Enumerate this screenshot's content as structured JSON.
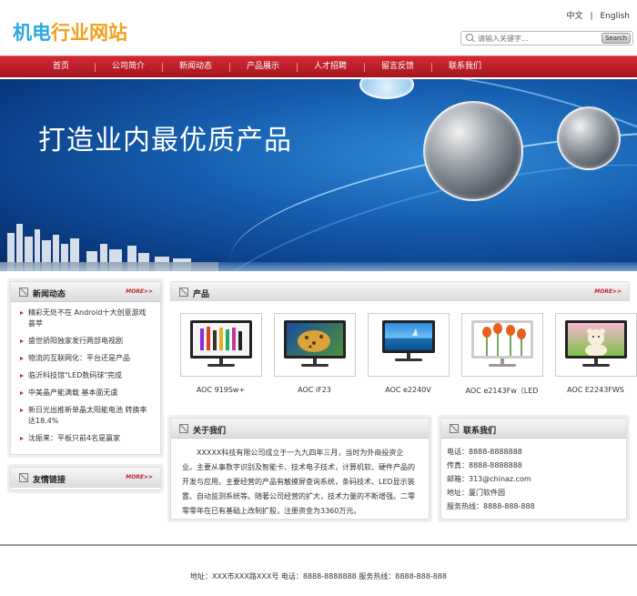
{
  "header": {
    "logo_part1": "机电",
    "logo_part2": "行业网站",
    "lang_cn": "中文",
    "lang_sep": "|",
    "lang_en": "English",
    "search_placeholder": "请输入关键字...",
    "search_button": "Search"
  },
  "nav": [
    "首页",
    "公司简介",
    "新闻动态",
    "产品展示",
    "人才招聘",
    "留言反馈",
    "联系我们"
  ],
  "banner": {
    "slogan": "打造业内最优质产品"
  },
  "news": {
    "title": "新闻动态",
    "more": "MORE>>",
    "items": [
      "精彩无处不在 Android十大创意游戏荟萃",
      "盛世骄阳独家发行两部电视剧",
      "物流的互联网化：平台还是产品",
      "临沂科技馆\"LED数码球\"完成",
      "中美晶产能满载 基本面无虞",
      "新日光出推新单晶太阳能电池 转换率达18.4%",
      "沈振来：平板只前4名是赢家"
    ]
  },
  "links": {
    "title": "友情链接",
    "more": "MORE>>"
  },
  "products": {
    "title": "产品",
    "more": "MORE>>",
    "items": [
      {
        "name": "AOC 919Sw+"
      },
      {
        "name": "AOC iF23"
      },
      {
        "name": "AOC e2240V"
      },
      {
        "name": "AOC e2143Fw（LED"
      },
      {
        "name": "AOC E2243FWS"
      }
    ]
  },
  "about": {
    "title": "关于我们",
    "text": "XXXXX科技有限公司成立于一九九四年三月，当时为外商投资企业。主要从事数字识别及智能卡、技术电子技术，计算机软、硬件产品的开发与应用。主要经营的产品有触摸屏查询系统，条码技术、LED显示装置、自动监测系统等。随著公司经营的扩大，技术力量的不断增强。二零零零年在已有基础上改制扩股，注册资金为3360万元。"
  },
  "contact": {
    "title": "联系我们",
    "items": [
      "电话：8888-8888888",
      "传真：8888-8888888",
      "邮箱：313@chinaz.com",
      "地址：厦门软件园",
      "服务热线：8888-888-888"
    ]
  },
  "footer": {
    "text": "地址：XXX市XXX路XXX号 电话：8888-8888888 服务热线：8888-888-888"
  },
  "colors": {
    "nav_red": "#c4232c",
    "logo_blue": "#2aa6e0",
    "logo_orange": "#f2a11d"
  }
}
